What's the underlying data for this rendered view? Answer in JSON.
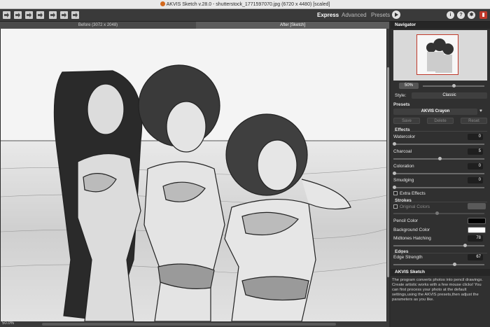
{
  "window": {
    "title": "AKVIS Sketch v.28.0 - shutterstock_1771597070.jpg (6720 x 4480) [scaled]"
  },
  "modes": {
    "express": "Express",
    "advanced": "Advanced",
    "presets": "Presets"
  },
  "tabs": {
    "before": "Before (3072 x 2048)",
    "after": "After [Sketch]"
  },
  "status": {
    "zoom": "50.0%"
  },
  "navigator": {
    "title": "Navigator",
    "zoom": "50%",
    "zoom_level": 0.5
  },
  "style": {
    "label": "Style:",
    "value": "Classic"
  },
  "presets": {
    "header": "Presets",
    "selected": "AKVIS Crayon",
    "save": "Save",
    "delete": "Delete",
    "reset": "Reset"
  },
  "effects": {
    "header": "Effects",
    "watercolor": {
      "label": "Watercolor",
      "value": "0"
    },
    "charcoal": {
      "label": "Charcoal",
      "value": "5"
    },
    "coloration": {
      "label": "Coloration",
      "value": "0"
    },
    "smudging": {
      "label": "Smudging",
      "value": "0"
    },
    "extra": "Extra Effects"
  },
  "strokes": {
    "header": "Strokes",
    "original_colors": "Original Colors",
    "pencil_color": "Pencil Color",
    "background_color": "Background Color",
    "midtones_hatching": {
      "label": "Midtones Hatching",
      "value": "78"
    }
  },
  "edges": {
    "header": "Edges",
    "edge_strength": {
      "label": "Edge Strength",
      "value": "67"
    }
  },
  "about": {
    "title": "AKVIS Sketch",
    "text": "The program converts photos into pencil drawings. Create artistic works with a few mouse clicks! You can first process your photo at the default settings,using the AKVIS presets,then adjust the parameters as you like."
  },
  "colors": {
    "pencil": "#000000",
    "background": "#ffffff",
    "accent": "#c0392b"
  }
}
